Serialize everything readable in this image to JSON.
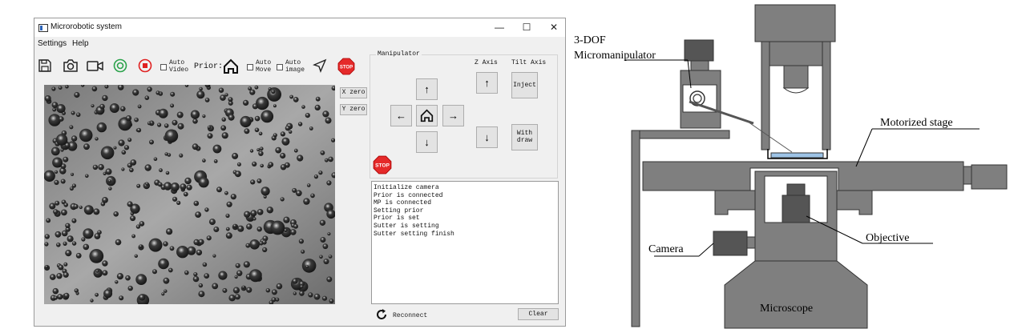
{
  "window": {
    "title": "Microrobotic system",
    "controls": {
      "minimize": "—",
      "maximize": "☐",
      "close": "✕"
    }
  },
  "menubar": {
    "items": [
      "Settings",
      "Help"
    ]
  },
  "toolbar": {
    "icons": [
      "save-icon",
      "camera-icon",
      "video-icon",
      "record-start-icon",
      "record-stop-icon",
      "home-icon",
      "navigate-icon",
      "stop-sign-icon"
    ],
    "auto_video": [
      "Auto",
      "Video"
    ],
    "prior_label": "Prior:",
    "auto_move": [
      "Auto",
      "Move"
    ],
    "auto_image": [
      "Auto",
      "image"
    ],
    "stop_label": "STOP"
  },
  "stage_buttons": {
    "x_zero": "X zero",
    "y_zero": "Y zero"
  },
  "manipulator": {
    "title": "Manipulator",
    "z_axis": "Z Axis",
    "tilt_axis": "Tilt Axis",
    "inject": "Inject",
    "withdraw": [
      "With",
      "draw"
    ],
    "stop_label": "STOP"
  },
  "log": {
    "lines": [
      "Initialize camera",
      "Prior is connected",
      "MP is connected",
      "Setting prior",
      "Prior is set",
      "Sutter is setting",
      "Sutter setting finish"
    ]
  },
  "footer": {
    "reconnect": "Reconnect",
    "clear": "Clear"
  },
  "diagram": {
    "labels": {
      "manipulator_line1": "3-DOF",
      "manipulator_line2": "Micromanipulator",
      "stage": "Motorized stage",
      "camera": "Camera",
      "objective": "Objective",
      "microscope": "Microscope"
    },
    "colors": {
      "body": "#7f7f7f",
      "outline": "#333333",
      "slide": "#9dc3e6",
      "lens": "#ffffff"
    }
  }
}
